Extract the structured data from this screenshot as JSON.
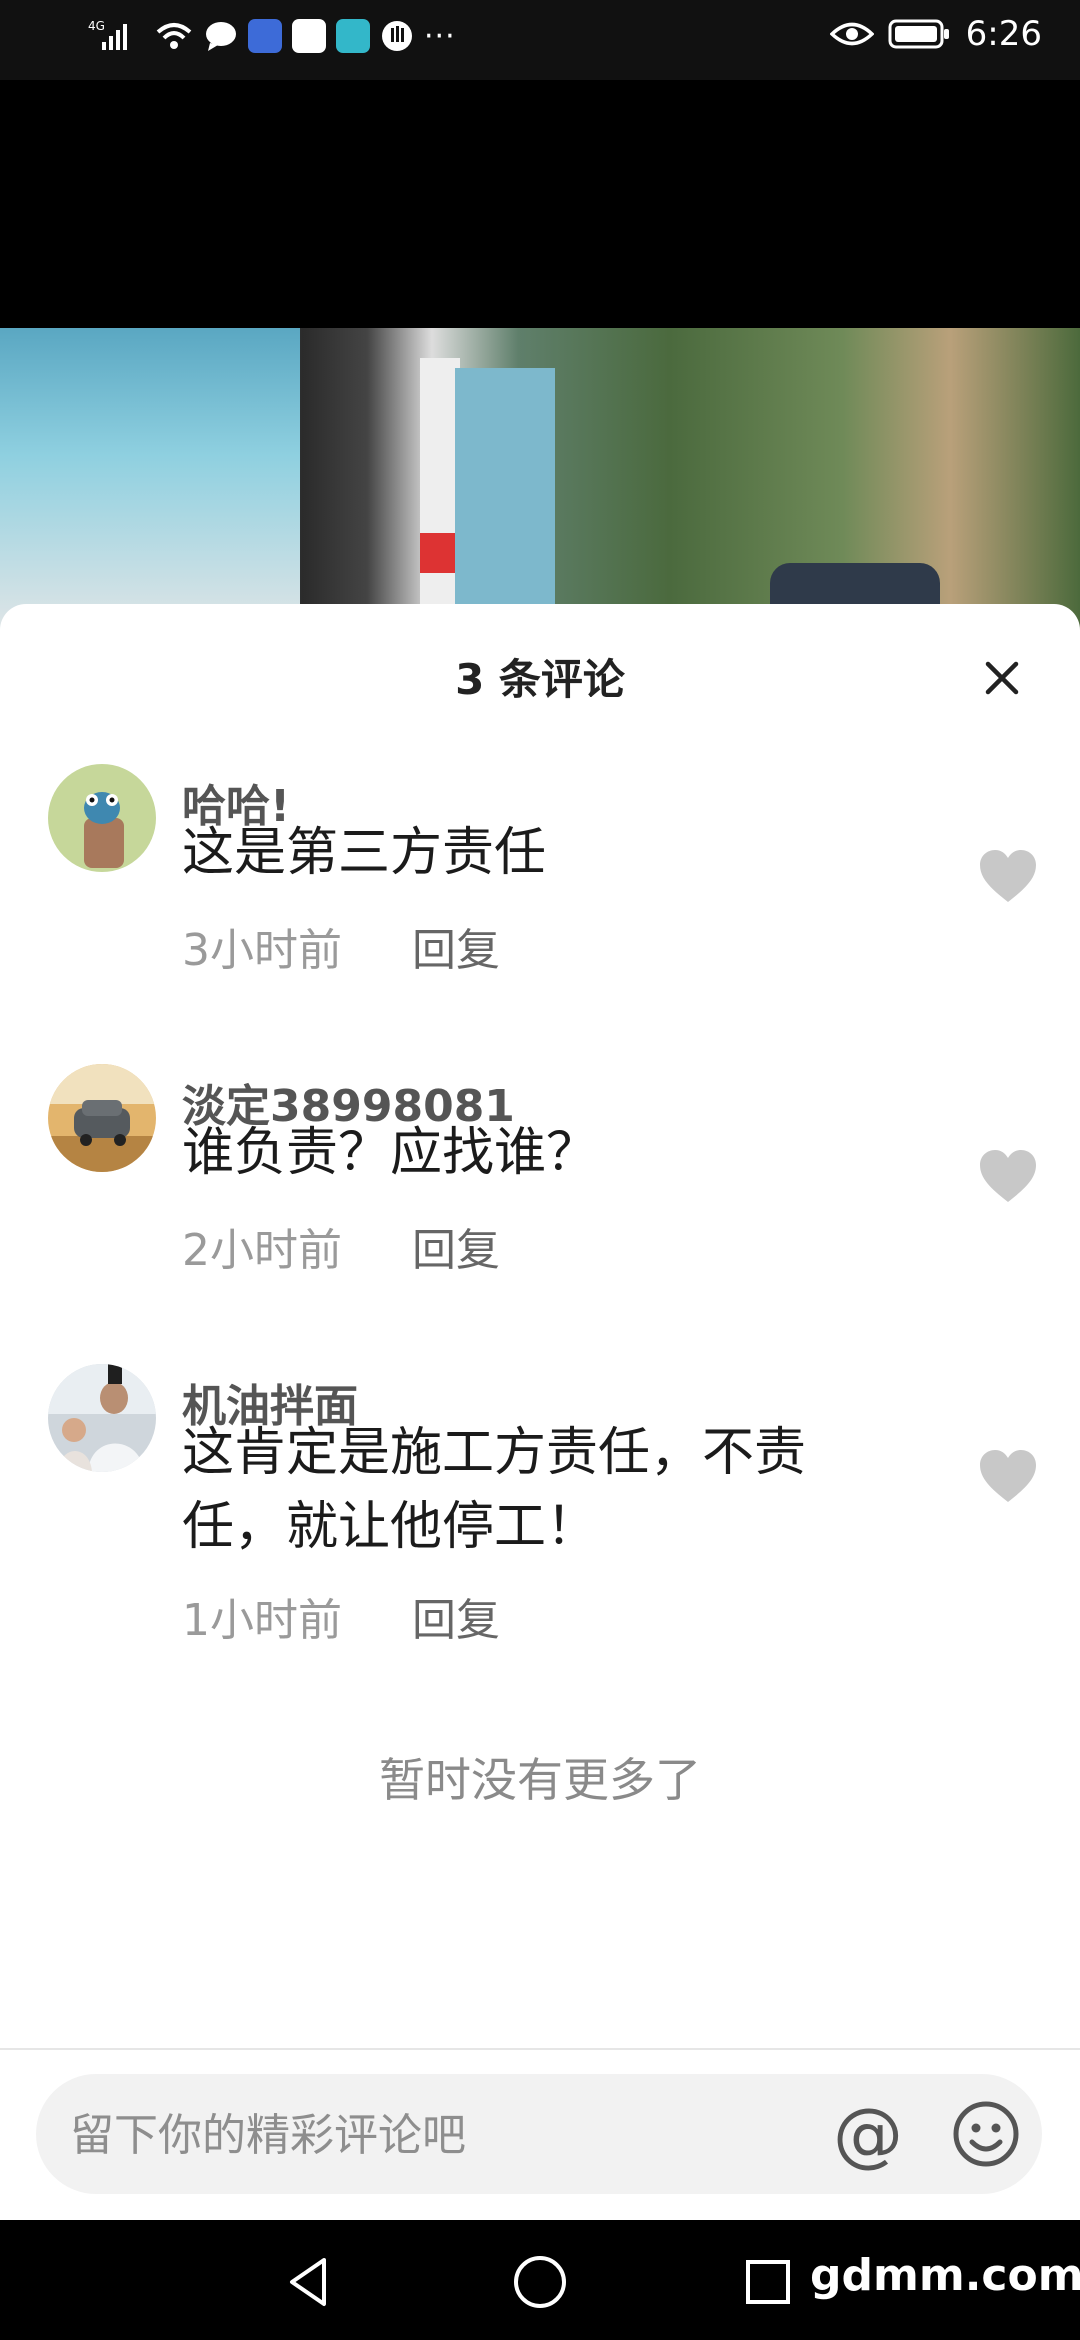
{
  "status_bar": {
    "network": "4G",
    "time": "6:26"
  },
  "sheet": {
    "title": "3 条评论",
    "close_icon": "close-icon"
  },
  "comments": [
    {
      "user": "哈哈!",
      "text": "这是第三方责任",
      "time": "3小时前",
      "reply": "回复",
      "avatar": "cartoon-bird-avatar"
    },
    {
      "user": "淡定38998081",
      "text": "谁负责？应找谁？",
      "time": "2小时前",
      "reply": "回复",
      "avatar": "car-photo-avatar"
    },
    {
      "user": "机油拌面",
      "text_line1": "这肯定是施工方责任，不责",
      "text_line2": "任，就让他停工！",
      "time": "1小时前",
      "reply": "回复",
      "avatar": "person-photo-avatar"
    }
  ],
  "end_note": "暂时没有更多了",
  "input": {
    "placeholder": "留下你的精彩评论吧",
    "at_symbol": "@"
  },
  "watermark": "gdmm.com",
  "colors": {
    "like_heart": "#c8c8c8",
    "sheet_bg": "#ffffff",
    "input_bg": "#f2f2f2"
  }
}
